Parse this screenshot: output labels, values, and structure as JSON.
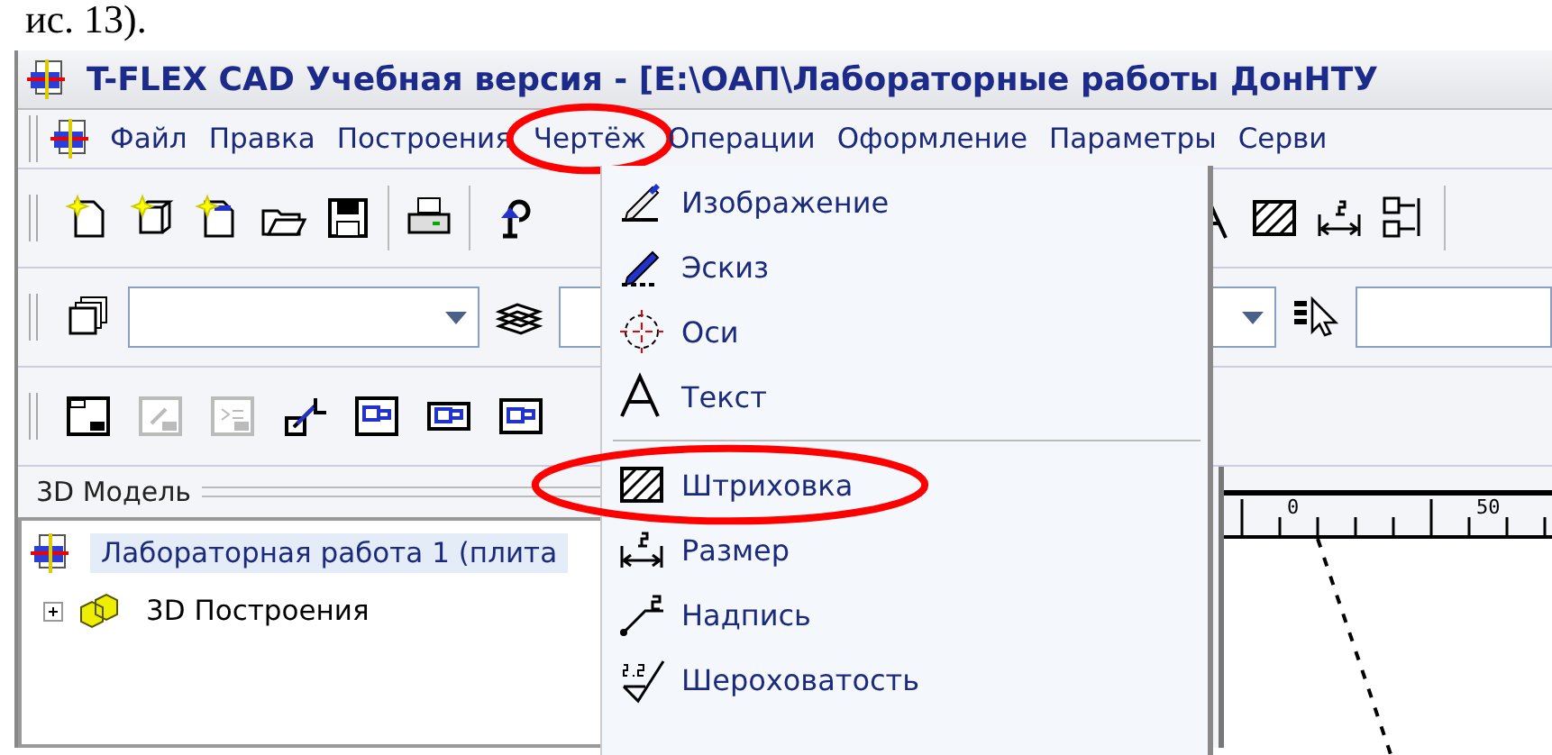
{
  "caption": "ис. 13).",
  "window": {
    "title": "T-FLEX CAD Учебная версия - [E:\\ОАП\\Лабораторные работы ДонНТУ"
  },
  "menu": [
    {
      "label": "Файл",
      "highlighted": false
    },
    {
      "label": "Правка",
      "highlighted": false
    },
    {
      "label": "Построения",
      "highlighted": false
    },
    {
      "label": "Чертёж",
      "highlighted": true
    },
    {
      "label": "Операции",
      "highlighted": false
    },
    {
      "label": "Оформление",
      "highlighted": false
    },
    {
      "label": "Параметры",
      "highlighted": false
    },
    {
      "label": "Серви",
      "highlighted": false
    }
  ],
  "dropdown": [
    {
      "kind": "item",
      "label": "Изображение",
      "highlighted": false
    },
    {
      "kind": "item",
      "label": "Эскиз",
      "highlighted": false
    },
    {
      "kind": "item",
      "label": "Оси",
      "highlighted": false
    },
    {
      "kind": "item",
      "label": "Текст",
      "highlighted": false
    },
    {
      "kind": "separator"
    },
    {
      "kind": "item",
      "label": "Штриховка",
      "highlighted": true
    },
    {
      "kind": "item",
      "label": "Размер",
      "highlighted": false
    },
    {
      "kind": "item",
      "label": "Надпись",
      "highlighted": false
    },
    {
      "kind": "item",
      "label": "Шероховатость",
      "highlighted": false
    }
  ],
  "toolbar_3": [
    {
      "disabled": false
    },
    {
      "disabled": true
    },
    {
      "disabled": true
    },
    {
      "disabled": false
    },
    {
      "disabled": false
    },
    {
      "disabled": false
    },
    {
      "disabled": false
    }
  ],
  "panel": {
    "title": "3D Модель"
  },
  "tree": [
    {
      "label": "Лабораторная работа 1 (плита",
      "selected": true,
      "children": [
        {
          "label": "3D Построения",
          "selected": false,
          "expanded": false
        }
      ]
    }
  ],
  "ruler": [
    "0",
    "50"
  ]
}
